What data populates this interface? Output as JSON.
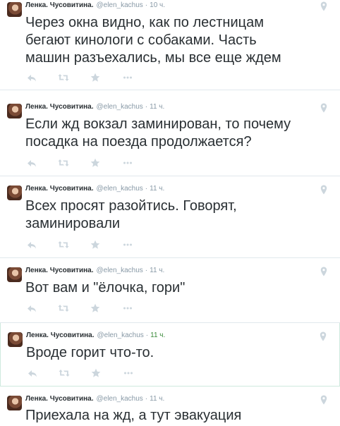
{
  "icons": {
    "avatar": "avatar-image",
    "location": "location-pin-icon",
    "reply": "reply-icon",
    "retweet": "retweet-icon",
    "favorite": "star-icon",
    "more": "more-dots-icon"
  },
  "colors": {
    "text": "#292f33",
    "muted": "#8899a6",
    "time_highlight": "#3a8a3a",
    "border": "#e1e8ed",
    "highlight_border": "#cfe9de",
    "icon": "#ccd6dd"
  },
  "tweets": [
    {
      "name": "Ленка. Чусовитина.",
      "handle": "@elen_kachus",
      "sep": "·",
      "time": "10 ч.",
      "text": "Через окна видно, как по лестницам\nбегают кинологи с собаками. Часть\nмашин разъехались, мы все еще ждем"
    },
    {
      "name": "Ленка. Чусовитина.",
      "handle": "@elen_kachus",
      "sep": "·",
      "time": "11 ч.",
      "text": "Если жд вокзал заминирован, то почему\nпосадка на поезда продолжается?"
    },
    {
      "name": "Ленка. Чусовитина.",
      "handle": "@elen_kachus",
      "sep": "·",
      "time": "11 ч.",
      "text": "Всех просят разойтись. Говорят,\nзаминировали"
    },
    {
      "name": "Ленка. Чусовитина.",
      "handle": "@elen_kachus",
      "sep": "·",
      "time": "11 ч.",
      "text": "Вот вам и \"ёлочка, гори\""
    },
    {
      "name": "Ленка. Чусовитина.",
      "handle": "@elen_kachus",
      "sep": "·",
      "time": "11 ч.",
      "text": "Вроде горит что-то."
    },
    {
      "name": "Ленка. Чусовитина.",
      "handle": "@elen_kachus",
      "sep": "·",
      "time": "11 ч.",
      "text": "Приехала на жд, а тут эвакуация"
    }
  ]
}
